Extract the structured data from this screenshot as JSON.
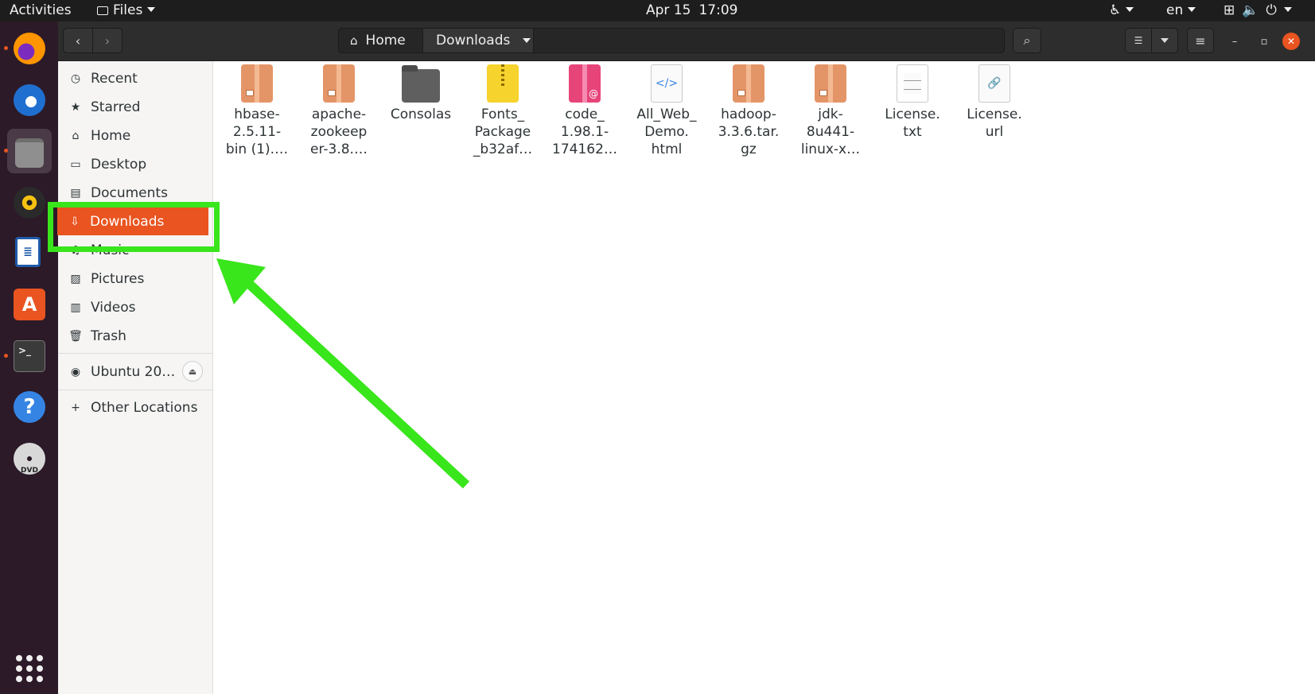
{
  "topbar": {
    "activities": "Activities",
    "app_menu": "Files",
    "date": "Apr 15",
    "time": "17:09",
    "language": "en"
  },
  "dock": {
    "items": [
      {
        "icon": "firefox-icon",
        "running": true
      },
      {
        "icon": "thunderbird-icon",
        "running": false
      },
      {
        "icon": "files-icon",
        "running": true,
        "active": true
      },
      {
        "icon": "rhythmbox-icon",
        "running": false
      },
      {
        "icon": "libreoffice-writer-icon",
        "running": false
      },
      {
        "icon": "ubuntu-software-icon",
        "running": false
      },
      {
        "icon": "terminal-icon",
        "running": true
      },
      {
        "icon": "help-icon",
        "running": false
      },
      {
        "icon": "dvd-icon",
        "running": false
      }
    ]
  },
  "header": {
    "path": [
      "Home",
      "Downloads"
    ]
  },
  "sidebar": {
    "items": [
      {
        "label": "Recent",
        "icon": "clock-icon"
      },
      {
        "label": "Starred",
        "icon": "star-icon"
      },
      {
        "label": "Home",
        "icon": "home-icon"
      },
      {
        "label": "Desktop",
        "icon": "desktop-icon"
      },
      {
        "label": "Documents",
        "icon": "documents-icon"
      },
      {
        "label": "Downloads",
        "icon": "download-icon",
        "selected": true
      },
      {
        "label": "Music",
        "icon": "music-icon"
      },
      {
        "label": "Pictures",
        "icon": "pictures-icon"
      },
      {
        "label": "Videos",
        "icon": "videos-icon"
      },
      {
        "label": "Trash",
        "icon": "trash-icon"
      }
    ],
    "device": {
      "label": "Ubuntu 20…",
      "icon": "disc-icon"
    },
    "other_locations": "Other Locations"
  },
  "files": [
    {
      "name": "hbase-\n2.5.11-\nbin (1).…",
      "type": "package"
    },
    {
      "name": "apache-\nzookeep\ner-3.8.…",
      "type": "package"
    },
    {
      "name": "Consolas",
      "type": "folder"
    },
    {
      "name": "Fonts_\nPackage\n_b32af…",
      "type": "zip"
    },
    {
      "name": "code_\n1.98.1-\n174162…",
      "type": "deb"
    },
    {
      "name": "All_Web_\nDemo.\nhtml",
      "type": "html"
    },
    {
      "name": "hadoop-\n3.3.6.tar.\ngz",
      "type": "package"
    },
    {
      "name": "jdk-\n8u441-\nlinux-x…",
      "type": "package"
    },
    {
      "name": "License.\ntxt",
      "type": "text"
    },
    {
      "name": "License.\nurl",
      "type": "url"
    }
  ],
  "colors": {
    "accent": "#e95420",
    "annotation": "#39e51b"
  }
}
